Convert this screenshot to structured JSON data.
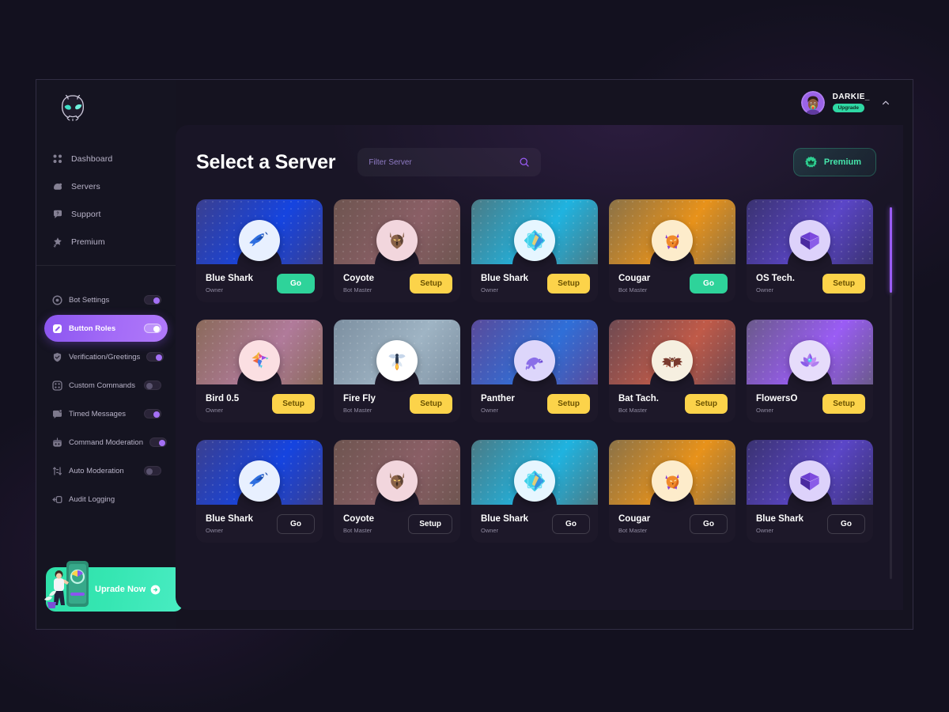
{
  "brand": {
    "logo_icon": "bot-mascot-logo"
  },
  "sidebar": {
    "nav": [
      {
        "label": "Dashboard",
        "icon": "grid-icon"
      },
      {
        "label": "Servers",
        "icon": "servers-icon"
      },
      {
        "label": "Support",
        "icon": "support-chat-icon"
      },
      {
        "label": "Premium",
        "icon": "sparkle-icon"
      }
    ],
    "settings": [
      {
        "label": "Bot Settings",
        "icon": "gear-icon",
        "toggle": "on",
        "active": false
      },
      {
        "label": "Button Roles",
        "icon": "button-roles-icon",
        "toggle": "on",
        "active": true
      },
      {
        "label": "Verification/Greetings",
        "icon": "shield-check-icon",
        "toggle": "on",
        "active": false
      },
      {
        "label": "Custom Commands",
        "icon": "custom-commands-icon",
        "toggle": "off",
        "active": false
      },
      {
        "label": "Timed Messages",
        "icon": "timed-message-icon",
        "toggle": "on",
        "active": false
      },
      {
        "label": "Command Moderation",
        "icon": "moderation-bot-icon",
        "toggle": "on",
        "active": false
      },
      {
        "label": "Auto Moderation",
        "icon": "auto-moderation-icon",
        "toggle": "off",
        "active": false
      },
      {
        "label": "Audit Logging",
        "icon": "audit-log-icon",
        "toggle": "none",
        "active": false
      }
    ],
    "upgrade": {
      "label": "Uprade Now",
      "arrow_icon": "arrow-right-circle-icon"
    }
  },
  "topbar": {
    "user_name": "DARKIE_",
    "user_badge": "Upgrade",
    "avatar_icon": "user-avatar",
    "chevron_icon": "chevron-up-icon"
  },
  "main": {
    "title": "Select a Server",
    "search": {
      "placeholder": "Filter Server",
      "value": "",
      "icon": "search-icon"
    },
    "premium_button": {
      "label": "Premium",
      "icon": "crown-badge-icon"
    },
    "colors": {
      "accent_purple": "#9a5cf5",
      "go_green": "#2ed39a",
      "setup_yellow": "#fcd34a",
      "premium_teal": "#46e5ab"
    }
  },
  "servers": [
    {
      "name": "Blue Shark",
      "role": "Owner",
      "action": "Go",
      "style": "go",
      "icon": "shark-icon",
      "b1": "#3b3f8f",
      "b2": "#1544e0",
      "circle": "#e8f0ff"
    },
    {
      "name": "Coyote",
      "role": "Bot Master",
      "action": "Setup",
      "style": "setup",
      "icon": "coyote-icon",
      "b1": "#6e5550",
      "b2": "#8a5f66",
      "circle": "#f2d6dd"
    },
    {
      "name": "Blue Shark",
      "role": "Owner",
      "action": "Setup",
      "style": "setup",
      "icon": "diamond-icon",
      "b1": "#4b7a84",
      "b2": "#1fb3e0",
      "circle": "#e6f6ff"
    },
    {
      "name": "Cougar",
      "role": "Bot Master",
      "action": "Go",
      "style": "go",
      "icon": "cougar-icon",
      "b1": "#8a7248",
      "b2": "#e8921a",
      "circle": "#fdeccb"
    },
    {
      "name": "OS Tech.",
      "role": "Owner",
      "action": "Setup",
      "style": "setup",
      "icon": "triangle-icon",
      "b1": "#3a3270",
      "b2": "#5b46c8",
      "circle": "#ddd2fb"
    },
    {
      "name": "Bird 0.5",
      "role": "Owner",
      "action": "Setup",
      "style": "setup",
      "icon": "bird-icon",
      "b1": "#8a6a5a",
      "b2": "#b07a9a",
      "circle": "#fbdfe2"
    },
    {
      "name": "Fire Fly",
      "role": "Bot Master",
      "action": "Setup",
      "style": "setup",
      "icon": "firefly-icon",
      "b1": "#7c8fa0",
      "b2": "#9fb4c4",
      "circle": "#ffffff"
    },
    {
      "name": "Panther",
      "role": "Owner",
      "action": "Setup",
      "style": "setup",
      "icon": "panther-icon",
      "b1": "#5a4a9a",
      "b2": "#2f6fd8",
      "circle": "#ddd6fb"
    },
    {
      "name": "Bat Tach.",
      "role": "Bot Master",
      "action": "Setup",
      "style": "setup",
      "icon": "bat-icon",
      "b1": "#6e4a52",
      "b2": "#c05a48",
      "circle": "#f6efe0"
    },
    {
      "name": "FlowersO",
      "role": "Owner",
      "action": "Setup",
      "style": "setup",
      "icon": "lotus-icon",
      "b1": "#6a5a8a",
      "b2": "#9a5cf5",
      "circle": "#e6dcfb"
    },
    {
      "name": "Blue Shark",
      "role": "Owner",
      "action": "Go",
      "style": "ghost",
      "icon": "shark-icon",
      "b1": "#3b3f8f",
      "b2": "#1544e0",
      "circle": "#e8f0ff"
    },
    {
      "name": "Coyote",
      "role": "Bot Master",
      "action": "Setup",
      "style": "ghost",
      "icon": "coyote-icon",
      "b1": "#6e5550",
      "b2": "#8a5f66",
      "circle": "#f2d6dd"
    },
    {
      "name": "Blue Shark",
      "role": "Owner",
      "action": "Go",
      "style": "ghost",
      "icon": "diamond-icon",
      "b1": "#4b7a84",
      "b2": "#1fb3e0",
      "circle": "#e6f6ff"
    },
    {
      "name": "Cougar",
      "role": "Bot Master",
      "action": "Go",
      "style": "ghost",
      "icon": "cougar-icon",
      "b1": "#8a7248",
      "b2": "#e8921a",
      "circle": "#fdeccb"
    },
    {
      "name": "Blue Shark",
      "role": "Owner",
      "action": "Go",
      "style": "ghost",
      "icon": "triangle-icon",
      "b1": "#3a3270",
      "b2": "#5b46c8",
      "circle": "#ddd2fb"
    }
  ]
}
